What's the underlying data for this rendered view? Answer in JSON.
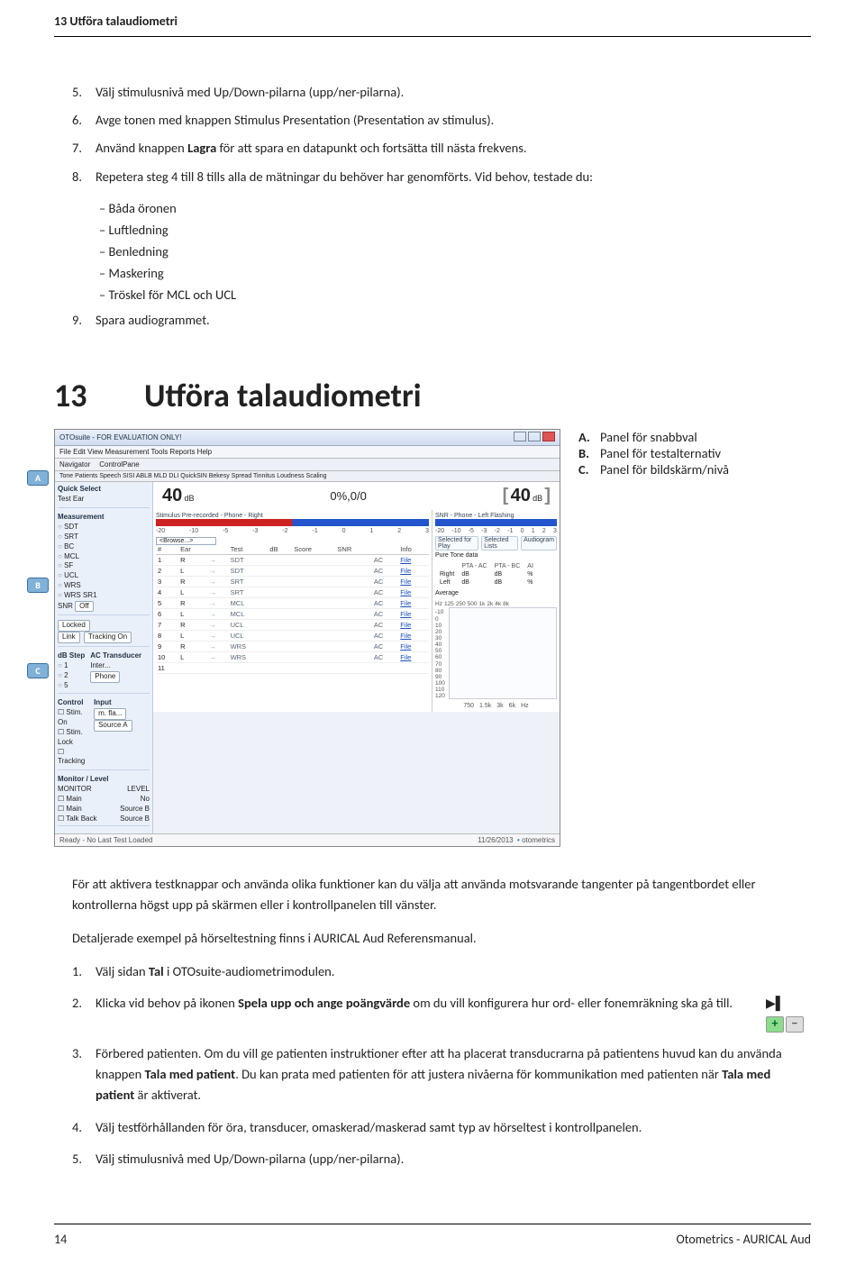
{
  "header": {
    "title": "13 Utföra talaudiometri"
  },
  "footer": {
    "pagenum": "14",
    "doc": "Otometrics - AURICAL Aud"
  },
  "upper_list": [
    {
      "n": "5.",
      "text": "Välj stimulusnivå med Up/Down-pilarna (upp/ner-pilarna)."
    },
    {
      "n": "6.",
      "text": "Avge tonen med knappen Stimulus Presentation (Presentation av stimulus)."
    },
    {
      "n": "7.",
      "pre": "Använd knappen ",
      "bold": "Lagra",
      "post": " för att spara en datapunkt och fortsätta till nästa frekvens."
    },
    {
      "n": "8.",
      "text": "Repetera steg 4 till 8 tills alla de mätningar du behöver har genomförts. Vid behov, testade du:"
    },
    {
      "n": "9.",
      "text": "Spara audiogrammet."
    }
  ],
  "upper_sub": [
    "Båda öronen",
    "Luftledning",
    "Benledning",
    "Maskering",
    "Tröskel för MCL och UCL"
  ],
  "section": {
    "num": "13",
    "title": "Utföra talaudiometri"
  },
  "legend": [
    {
      "let": "A.",
      "text": "Panel för snabbval"
    },
    {
      "let": "B.",
      "text": "Panel för testalternativ"
    },
    {
      "let": "C.",
      "text": "Panel för bildskärm/nivå"
    }
  ],
  "body1": "För att aktivera testknappar och använda olika funktioner kan du välja att använda motsvarande tangenter på tangentbordet eller kontrollerna högst upp på skärmen eller i kontrollpanelen till vänster.",
  "body2": "Detaljerade exempel på hörseltestning finns i AURICAL Aud Referensmanual.",
  "lower_list": {
    "i1": {
      "n": "1.",
      "pre": "Välj sidan ",
      "bold": "Tal",
      "post": " i OTOsuite-audiometrimodulen."
    },
    "i2": {
      "n": "2.",
      "pre": "Klicka vid behov på ikonen ",
      "bold": "Spela upp och ange poängvärde",
      "post": " om du vill konfigurera hur ord- eller fonemräkning ska gå till."
    },
    "i3": {
      "n": "3.",
      "pre": "Förbered patienten. Om du vill ge patienten instruktioner efter att ha placerat transducrarna på patientens huvud kan du använda knappen ",
      "bold1": "Tala med patient",
      "mid": ". Du kan prata med patienten för att justera nivåerna för kommunikation med patienten när ",
      "bold2": "Tala med patient",
      "post": " är aktiverat."
    },
    "i4": {
      "n": "4.",
      "text": "Välj testförhållanden för öra, transducer, omaskerad/maskerad samt typ av hörseltest i kontrollpanelen."
    },
    "i5": {
      "n": "5.",
      "text": "Välj stimulusnivå med Up/Down-pilarna (upp/ner-pilarna)."
    }
  },
  "shot": {
    "title": "OTOsuite - FOR EVALUATION ONLY!",
    "menu": "File  Edit  View  Measurement  Tools  Reports  Help",
    "nav_lbl": "Navigator",
    "cp_lbl": "ControlPane",
    "tabs": "Tone   Patients   Speech   SISI   ABLB   MLD   DLI   QuickSIN   Bekesy   Spread   Tinnitus   Loudness Scaling",
    "dial_left": {
      "big": "40",
      "unit": "dB"
    },
    "dial_mid": "0%,0/0",
    "dial_right": {
      "lb": "[",
      "big": "40",
      "unit": "dB",
      "rb": "]"
    },
    "qs": "Quick Select",
    "testear": "Test Ear",
    "ma": "Measurement",
    "ma_items": [
      "SDT",
      "SRT",
      "BC",
      "MCL",
      "SF",
      "UCL",
      "WRS",
      "WRS SR1"
    ],
    "snr_lbl": "SNR",
    "snr_val": "Off",
    "locked": "Locked",
    "lnk": "Link",
    "trackon": "Tracking On",
    "dbstep": "dB Step",
    "actr": "AC Transducer",
    "intr": "Inter...",
    "phone": "Phone",
    "control": "Control",
    "input": "Input",
    "stimon": "Stim. On",
    "flav": "m. fla...",
    "stimlock": "Stim. Lock",
    "source": "Source A",
    "tracking": "Tracking",
    "monitorlevel": "Monitor / Level",
    "monitor": "MONITOR",
    "level": "LEVEL",
    "main": "Main",
    "no": "No",
    "srcb": "Source B",
    "talkback": "Talk Back",
    "stimline": "Stimulus Pre-recorded - Phone - Right",
    "snrline": "SNR - Phone - Left  Flashing",
    "scalevals": [
      "-20",
      "-10",
      "-5",
      "-3",
      "-2",
      "-1",
      "0",
      "1",
      "2",
      "3"
    ],
    "scalevals2": [
      "-20",
      "-10",
      "-5",
      "-3",
      "-2",
      "-1",
      "0",
      "1",
      "2",
      "3"
    ],
    "browse": "<Browse...>",
    "th": [
      "#",
      "Ear",
      "Test",
      "dB",
      "Score",
      "SNR",
      "Info"
    ],
    "rows": [
      {
        "n": "1",
        "ear": "R",
        "t": "SDT",
        "tr": "AC"
      },
      {
        "n": "2",
        "ear": "L",
        "t": "SDT",
        "tr": "AC"
      },
      {
        "n": "3",
        "ear": "R",
        "t": "SRT",
        "tr": "AC"
      },
      {
        "n": "4",
        "ear": "L",
        "t": "SRT",
        "tr": "AC"
      },
      {
        "n": "5",
        "ear": "R",
        "t": "MCL",
        "tr": "AC"
      },
      {
        "n": "6",
        "ear": "L",
        "t": "MCL",
        "tr": "AC"
      },
      {
        "n": "7",
        "ear": "R",
        "t": "UCL",
        "tr": "AC"
      },
      {
        "n": "8",
        "ear": "L",
        "t": "UCL",
        "tr": "AC"
      },
      {
        "n": "9",
        "ear": "R",
        "t": "WRS",
        "tr": "AC"
      },
      {
        "n": "10",
        "ear": "L",
        "t": "WRS",
        "tr": "AC"
      },
      {
        "n": "11",
        "ear": "",
        "t": "",
        "tr": ""
      }
    ],
    "file": "File",
    "rp_tabs": [
      "Selected for Play",
      "Selected Lists",
      "Audiogram"
    ],
    "pt_title": "Pure Tone data",
    "pt_hdr": [
      "",
      "PTA - AC",
      "PTA - BC",
      "AI"
    ],
    "pt_r1": [
      "Right",
      "dB",
      "dB",
      "%"
    ],
    "pt_r2": [
      "Left",
      "dB",
      "dB",
      "%"
    ],
    "average": "Average",
    "freqrow": [
      "Hz",
      "125",
      "250",
      "500",
      "1k",
      "2k",
      "4k",
      "8k"
    ],
    "dbcol": [
      "-10",
      "0",
      "10",
      "20",
      "30",
      "40",
      "50",
      "60",
      "70",
      "80",
      "90",
      "100",
      "110",
      "120"
    ],
    "botfreq": [
      "750",
      "1.5k",
      "3k",
      "6k",
      "Hz"
    ],
    "status_l": "Ready - No Last Test Loaded",
    "status_date": "11/26/2013",
    "status_brand": "otometrics"
  }
}
